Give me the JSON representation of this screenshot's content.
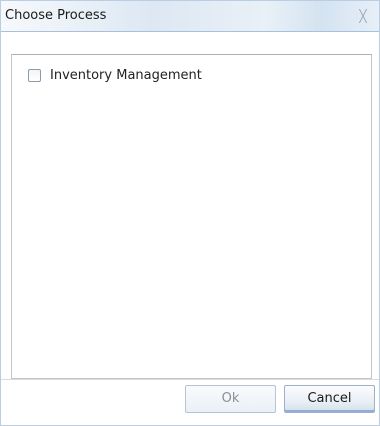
{
  "dialog": {
    "title": "Choose Process",
    "close_icon": "close-icon"
  },
  "process_list": {
    "items": [
      {
        "label": "Inventory Management",
        "checked": false
      }
    ]
  },
  "buttons": {
    "ok_label": "Ok",
    "ok_enabled": false,
    "cancel_label": "Cancel"
  }
}
